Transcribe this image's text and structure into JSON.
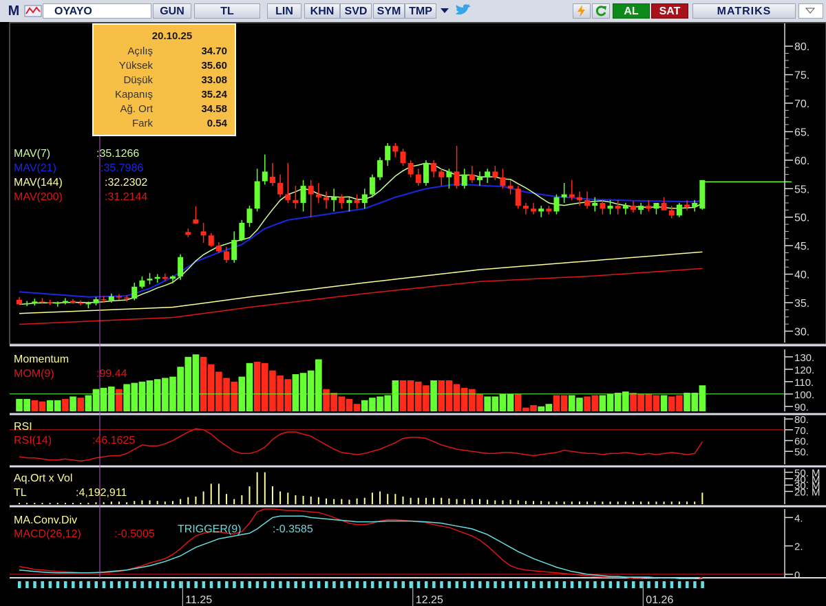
{
  "toolbar": {
    "logo": "M",
    "symbol": "OYAYO",
    "buttons": [
      "GUN",
      "TL",
      "LIN",
      "KHN",
      "SVD",
      "SYM",
      "TMP"
    ],
    "al": "AL",
    "sat": "SAT",
    "brand": "MATRIKS"
  },
  "colors": {
    "bg": "#000000",
    "up": "#66ff33",
    "down": "#ff2a1a",
    "mav7": "#ccff99",
    "mav21": "#1a28e6",
    "mav144": "#ffff99",
    "mav200": "#e01515",
    "tooltip": "#f7bf45",
    "cyan": "#66dde0",
    "gridline": "#cccccc"
  },
  "chart_data": [
    {
      "type": "candlestick",
      "panel": "price",
      "x_labels": [
        "11.25",
        "12.25",
        "01.26"
      ],
      "y_ticks": [
        "30.",
        "35.",
        "40.",
        "45.",
        "50.",
        "55.",
        "60.",
        "65.",
        "70.",
        "75.",
        "80."
      ],
      "ylim": [
        28,
        84
      ],
      "candles": [
        [
          35.5,
          36.0,
          34.8,
          34.7
        ],
        [
          34.7,
          35.3,
          34.4,
          34.9
        ],
        [
          34.9,
          35.7,
          34.5,
          35.2
        ],
        [
          35.2,
          35.8,
          34.8,
          35.1
        ],
        [
          35.1,
          35.5,
          34.6,
          34.9
        ],
        [
          34.9,
          35.2,
          34.3,
          35.0
        ],
        [
          35.0,
          35.8,
          34.7,
          35.3
        ],
        [
          35.3,
          35.6,
          34.8,
          35.0
        ],
        [
          35.0,
          35.4,
          34.5,
          34.8
        ],
        [
          34.8,
          35.2,
          34.0,
          34.9
        ],
        [
          34.9,
          36.0,
          34.5,
          35.6
        ],
        [
          35.6,
          36.2,
          35.0,
          35.4
        ],
        [
          35.4,
          36.6,
          35.0,
          36.1
        ],
        [
          36.1,
          36.5,
          35.5,
          35.9
        ],
        [
          35.9,
          36.3,
          35.2,
          35.7
        ],
        [
          35.7,
          38.5,
          35.4,
          37.8
        ],
        [
          37.8,
          39.6,
          37.5,
          38.9
        ],
        [
          38.9,
          40.2,
          38.2,
          39.2
        ],
        [
          39.2,
          40.0,
          38.5,
          39.5
        ],
        [
          39.5,
          40.1,
          38.8,
          39.2
        ],
        [
          39.2,
          39.8,
          38.4,
          39.6
        ],
        [
          39.6,
          43.5,
          39.0,
          43.0
        ],
        [
          47.4,
          48.0,
          46.5,
          46.9
        ],
        [
          49.6,
          51.9,
          48.8,
          48.9
        ],
        [
          47.5,
          49.0,
          45.5,
          46.8
        ],
        [
          46.8,
          47.2,
          44.8,
          45.0
        ],
        [
          45.0,
          45.6,
          43.7,
          44.0
        ],
        [
          44.0,
          44.8,
          42.0,
          42.5
        ],
        [
          42.5,
          47.5,
          42.0,
          46.0
        ],
        [
          46.0,
          49.5,
          45.8,
          49.0
        ],
        [
          49.0,
          52.0,
          48.3,
          51.5
        ],
        [
          51.5,
          58.5,
          51.0,
          56.3
        ],
        [
          56.3,
          61.0,
          55.7,
          58.0
        ],
        [
          57.1,
          59.5,
          55.5,
          56.0
        ],
        [
          56.0,
          57.5,
          53.5,
          54.0
        ],
        [
          54.0,
          59.5,
          52.5,
          53.0
        ],
        [
          53.0,
          55.5,
          51.5,
          52.5
        ],
        [
          52.5,
          56.5,
          51.0,
          55.5
        ],
        [
          55.5,
          56.5,
          50.0,
          54.0
        ],
        [
          54.0,
          56.0,
          52.5,
          53.5
        ],
        [
          53.5,
          54.5,
          51.5,
          53.0
        ],
        [
          53.0,
          55.0,
          51.0,
          53.5
        ],
        [
          53.5,
          54.0,
          51.5,
          52.5
        ],
        [
          52.5,
          53.5,
          51.0,
          53.0
        ],
        [
          53.0,
          54.0,
          51.5,
          52.5
        ],
        [
          52.5,
          55.0,
          51.5,
          54.0
        ],
        [
          54.0,
          57.5,
          53.5,
          57.0
        ],
        [
          57.0,
          60.5,
          56.5,
          60.0
        ],
        [
          60.0,
          63.0,
          59.0,
          62.5
        ],
        [
          62.5,
          63.0,
          60.5,
          61.5
        ],
        [
          61.5,
          62.0,
          59.0,
          59.5
        ],
        [
          59.5,
          60.0,
          57.0,
          57.5
        ],
        [
          57.5,
          58.5,
          55.5,
          56.0
        ],
        [
          56.0,
          60.0,
          55.5,
          59.5
        ],
        [
          59.5,
          60.0,
          57.0,
          58.0
        ],
        [
          58.0,
          58.5,
          55.5,
          57.0
        ],
        [
          57.0,
          58.5,
          55.0,
          58.0
        ],
        [
          58.0,
          62.5,
          55.0,
          55.5
        ],
        [
          55.5,
          58.5,
          55.0,
          57.5
        ],
        [
          57.5,
          59.0,
          56.0,
          56.5
        ],
        [
          56.5,
          58.0,
          55.5,
          57.0
        ],
        [
          57.0,
          58.5,
          56.0,
          58.0
        ],
        [
          58.0,
          59.0,
          56.5,
          57.0
        ],
        [
          57.0,
          58.5,
          55.0,
          55.5
        ],
        [
          55.5,
          56.5,
          54.0,
          55.0
        ],
        [
          55.0,
          55.5,
          51.5,
          52.0
        ],
        [
          52.0,
          52.5,
          50.5,
          51.5
        ],
        [
          51.5,
          52.5,
          50.5,
          51.0
        ],
        [
          51.0,
          52.0,
          50.0,
          51.5
        ],
        [
          51.5,
          52.0,
          50.5,
          51.0
        ],
        [
          51.0,
          54.0,
          50.5,
          53.5
        ],
        [
          53.5,
          56.0,
          52.5,
          54.0
        ],
        [
          54.0,
          56.5,
          53.0,
          53.5
        ],
        [
          53.5,
          54.5,
          52.0,
          53.0
        ],
        [
          53.0,
          54.5,
          51.5,
          52.0
        ],
        [
          52.0,
          53.5,
          51.0,
          52.5
        ],
        [
          52.5,
          53.0,
          50.5,
          51.5
        ],
        [
          51.5,
          53.0,
          50.5,
          52.0
        ],
        [
          52.0,
          53.0,
          50.5,
          51.5
        ],
        [
          51.5,
          52.5,
          50.5,
          52.0
        ],
        [
          52.0,
          52.8,
          50.8,
          51.3
        ],
        [
          51.3,
          52.5,
          50.5,
          52.0
        ],
        [
          52.0,
          53.0,
          51.0,
          51.5
        ],
        [
          51.5,
          52.5,
          50.5,
          52.5
        ],
        [
          52.5,
          53.5,
          51.5,
          51.2
        ],
        [
          51.2,
          52.0,
          49.8,
          50.3
        ],
        [
          50.3,
          52.5,
          50.0,
          52.2
        ],
        [
          52.2,
          53.0,
          51.2,
          51.8
        ],
        [
          51.8,
          53.0,
          51.0,
          52.5
        ],
        [
          51.5,
          56.5,
          51.3,
          56.5
        ]
      ],
      "last_price": 56.2,
      "tooltip": {
        "date": "20.10.25",
        "rows": [
          {
            "label": "Açılış",
            "value": "34.70"
          },
          {
            "label": "Yüksek",
            "value": "35.60"
          },
          {
            "label": "Düşük",
            "value": "33.08"
          },
          {
            "label": "Kapanış",
            "value": "35.24"
          },
          {
            "label": "Ağ. Ort",
            "value": "34.58"
          },
          {
            "label": "Fark",
            "value": "0.54"
          }
        ]
      },
      "series": [
        {
          "name": "MAV(7)",
          "value": ":35.1266"
        },
        {
          "name": "MAV(21)",
          "value": ":35.7986"
        },
        {
          "name": "MAV(144)",
          "value": ":32.2302"
        },
        {
          "name": "MAV(200)",
          "value": ":31.2144"
        }
      ],
      "mav21_anchors": [
        [
          0,
          36.9
        ],
        [
          9,
          36.0
        ],
        [
          14,
          36.2
        ],
        [
          17,
          37.5
        ],
        [
          20,
          39.5
        ],
        [
          23,
          42.2
        ],
        [
          26,
          43.8
        ],
        [
          29,
          45.2
        ],
        [
          32,
          48.0
        ],
        [
          35,
          49.5
        ],
        [
          40,
          50.5
        ],
        [
          45,
          51.5
        ],
        [
          49,
          53.5
        ],
        [
          53,
          55.0
        ],
        [
          57,
          55.8
        ],
        [
          61,
          55.5
        ],
        [
          63,
          55.4
        ],
        [
          66,
          54.4
        ],
        [
          70,
          53.6
        ],
        [
          75,
          53.1
        ],
        [
          80,
          52.9
        ],
        [
          84,
          52.8
        ],
        [
          88,
          52.7
        ],
        [
          89,
          52.9
        ]
      ],
      "mav144_anchors": [
        [
          0,
          33.1
        ],
        [
          20,
          34.2
        ],
        [
          30,
          36.0
        ],
        [
          45,
          38.5
        ],
        [
          60,
          40.8
        ],
        [
          75,
          42.4
        ],
        [
          89,
          43.9
        ]
      ],
      "mav200_anchors": [
        [
          0,
          31.2
        ],
        [
          20,
          32.4
        ],
        [
          30,
          34.2
        ],
        [
          45,
          36.6
        ],
        [
          60,
          38.7
        ],
        [
          75,
          39.7
        ],
        [
          89,
          41.0
        ]
      ]
    },
    {
      "type": "bar",
      "panel": "momentum",
      "title": "Momentum",
      "series": [
        {
          "name": "MOM(9)",
          "value": ":99.44"
        }
      ],
      "y_ticks": [
        "90.",
        "100.",
        "110.",
        "120.",
        "130."
      ],
      "ylim": [
        86,
        136
      ],
      "baseline": 100,
      "values": [
        96,
        96,
        95,
        94,
        95,
        95,
        96,
        98,
        97,
        99,
        104,
        105,
        106,
        104,
        108,
        109,
        110,
        111,
        112,
        113,
        114,
        122,
        130,
        132,
        130,
        124,
        118,
        113,
        110,
        114,
        125,
        126,
        125,
        119,
        115,
        112,
        116,
        117,
        119,
        128,
        104,
        101,
        98,
        96,
        92,
        95,
        97,
        98,
        99,
        111,
        111,
        111,
        110,
        107,
        111,
        111,
        111,
        108,
        105,
        104,
        100,
        98,
        98,
        100,
        100,
        100,
        89,
        91,
        90,
        92,
        99,
        99,
        99,
        97,
        98,
        99,
        99,
        100,
        101,
        102,
        101,
        100,
        100,
        99,
        99,
        98,
        99,
        101,
        101,
        107
      ],
      "up": [
        1,
        1,
        0,
        0,
        1,
        1,
        0,
        1,
        0,
        1,
        1,
        1,
        1,
        0,
        1,
        1,
        1,
        1,
        1,
        1,
        1,
        1,
        1,
        1,
        0,
        0,
        0,
        0,
        0,
        1,
        1,
        0,
        0,
        0,
        0,
        0,
        1,
        1,
        1,
        1,
        0,
        0,
        0,
        0,
        0,
        1,
        1,
        1,
        1,
        1,
        0,
        0,
        0,
        0,
        1,
        0,
        0,
        0,
        0,
        0,
        0,
        1,
        1,
        1,
        1,
        0,
        0,
        0,
        1,
        1,
        0,
        0,
        1,
        1,
        0,
        0,
        1,
        1,
        1,
        1,
        0,
        0,
        0,
        0,
        1,
        0,
        0,
        1,
        1,
        1
      ]
    },
    {
      "type": "line",
      "panel": "rsi",
      "title": "RSI",
      "series": [
        {
          "name": "RSI(14)",
          "value": ":46.1625"
        }
      ],
      "y_ticks": [
        "50.",
        "60.",
        "70.",
        "80."
      ],
      "ylim": [
        38,
        82
      ],
      "values": [
        45,
        44,
        44,
        43,
        42,
        42,
        43,
        42,
        41,
        42,
        44,
        45,
        46,
        46,
        48,
        52,
        56,
        55,
        55,
        57,
        60,
        64,
        68,
        71,
        70,
        66,
        60,
        55,
        50,
        48,
        48,
        50,
        54,
        61,
        66,
        68,
        68,
        66,
        64,
        60,
        56,
        52,
        49,
        48,
        47,
        48,
        50,
        52,
        55,
        58,
        62,
        63,
        63,
        62,
        59,
        56,
        54,
        52,
        51,
        50,
        49,
        48,
        48,
        49,
        49,
        48,
        47,
        46,
        47,
        48,
        49,
        51,
        50,
        49,
        48,
        48,
        47,
        48,
        48,
        49,
        48,
        47,
        48,
        47,
        48,
        49,
        48,
        47,
        48,
        59
      ]
    },
    {
      "type": "bar",
      "panel": "volume",
      "title": "Aq.Ort x Vol",
      "series": [
        {
          "name": "TL",
          "value": ":4,192,911"
        }
      ],
      "y_ticks": [
        "20. M",
        "30. M",
        "40. M",
        "50. M"
      ],
      "ylim": [
        0,
        56
      ],
      "values": [
        2,
        2,
        2,
        2,
        2,
        2,
        2,
        2,
        2,
        2,
        3,
        3,
        4,
        4,
        3,
        5,
        6,
        6,
        5,
        4,
        5,
        8,
        11,
        12,
        20,
        32,
        32,
        16,
        8,
        14,
        28,
        50,
        50,
        28,
        20,
        18,
        14,
        13,
        12,
        11,
        9,
        8,
        8,
        7,
        9,
        10,
        18,
        20,
        16,
        16,
        12,
        10,
        10,
        10,
        10,
        10,
        9,
        8,
        8,
        8,
        8,
        7,
        6,
        6,
        7,
        6,
        5,
        5,
        5,
        4,
        4,
        4,
        4,
        4,
        4,
        4,
        4,
        4,
        4,
        4,
        4,
        4,
        4,
        4,
        4,
        4,
        4,
        4,
        4,
        18
      ]
    },
    {
      "type": "line",
      "panel": "macd",
      "title": "MA.Conv.Div",
      "series": [
        {
          "name": "MACD(26,12)",
          "value": ":-0.5005"
        },
        {
          "name": "TRIGGER(9)",
          "value": ":-0.3585"
        }
      ],
      "y_ticks": [
        "0",
        "2.",
        "4."
      ],
      "ylim": [
        -0.2,
        4.6
      ],
      "macd": [
        0.55,
        0.45,
        0.35,
        0.3,
        0.25,
        0.2,
        0.18,
        0.15,
        0.1,
        0.1,
        0.1,
        0.12,
        0.15,
        0.2,
        0.3,
        0.45,
        0.6,
        0.8,
        0.95,
        1.1,
        1.4,
        1.8,
        2.3,
        2.7,
        2.9,
        3.0,
        3.0,
        2.9,
        2.85,
        3.0,
        3.6,
        4.4,
        4.6,
        4.6,
        4.55,
        4.5,
        4.5,
        4.45,
        4.4,
        4.35,
        4.2,
        4.0,
        3.8,
        3.6,
        3.5,
        3.5,
        3.6,
        3.75,
        3.85,
        3.85,
        3.8,
        3.75,
        3.7,
        3.65,
        3.5,
        3.4,
        3.3,
        3.1,
        2.9,
        2.7,
        2.4,
        2.0,
        1.5,
        1.0,
        0.6,
        0.4,
        0.3,
        0.25,
        0.2,
        0.15,
        0.1,
        0.05,
        0.0,
        -0.05,
        -0.1,
        -0.15,
        -0.2,
        -0.2,
        -0.2,
        -0.2,
        -0.3,
        -0.3,
        -0.35,
        -0.35,
        -0.4,
        -0.4,
        -0.45,
        -0.45,
        -0.45,
        -0.2
      ],
      "trigger": [
        0.3,
        0.25,
        0.2,
        0.15,
        0.12,
        0.1,
        0.1,
        0.1,
        0.1,
        0.1,
        0.12,
        0.15,
        0.2,
        0.25,
        0.3,
        0.4,
        0.5,
        0.6,
        0.75,
        0.9,
        1.1,
        1.3,
        1.6,
        1.9,
        2.1,
        2.3,
        2.5,
        2.6,
        2.7,
        2.8,
        2.9,
        3.2,
        3.6,
        4.0,
        4.1,
        4.1,
        4.1,
        4.1,
        4.0,
        3.95,
        3.9,
        3.85,
        3.8,
        3.75,
        3.7,
        3.7,
        3.7,
        3.72,
        3.75,
        3.75,
        3.75,
        3.75,
        3.72,
        3.7,
        3.65,
        3.6,
        3.5,
        3.4,
        3.3,
        3.2,
        3.0,
        2.8,
        2.5,
        2.2,
        1.9,
        1.6,
        1.35,
        1.1,
        0.9,
        0.7,
        0.5,
        0.35,
        0.2,
        0.1,
        0.0,
        -0.05,
        -0.1,
        -0.15,
        -0.15,
        -0.2,
        -0.2,
        -0.2,
        -0.2,
        -0.25,
        -0.25,
        -0.25,
        -0.3,
        -0.3,
        -0.3,
        -0.35
      ]
    }
  ]
}
